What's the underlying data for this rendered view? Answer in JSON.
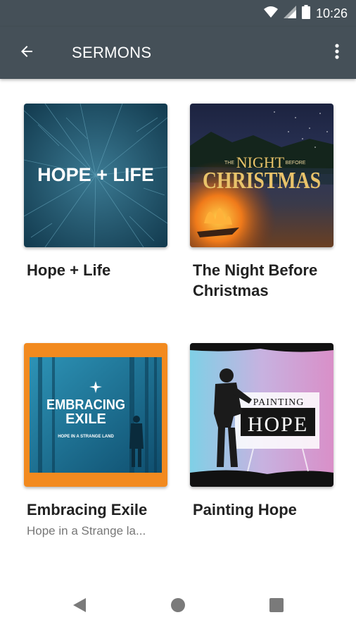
{
  "status_bar": {
    "time": "10:26",
    "icons": [
      "wifi-icon",
      "cellular-signal-icon",
      "battery-icon"
    ]
  },
  "app_bar": {
    "title": "SERMONS",
    "back_icon": "arrow-back-icon",
    "menu_icon": "more-vert-icon"
  },
  "sermons": [
    {
      "title": "Hope + Life",
      "subtitle": "",
      "art_text": "HOPE + LIFE"
    },
    {
      "title": "The Night Before Christmas",
      "subtitle": "",
      "art_text_top": "NIGHT",
      "art_text_small_left": "THE",
      "art_text_small_right": "BEFORE",
      "art_text_main": "CHRISTMAS"
    },
    {
      "title": "Embracing Exile",
      "subtitle": "Hope in a Strange la...",
      "art_text_line1": "EMBRACING",
      "art_text_line2": "EXILE",
      "art_text_sub": "HOPE IN A STRANGE LAND"
    },
    {
      "title": "Painting Hope",
      "subtitle": "",
      "art_text_top": "PAINTING",
      "art_text_main": "HOPE"
    }
  ],
  "nav_bar": {
    "icons": [
      "back-triangle-icon",
      "home-circle-icon",
      "recents-square-icon"
    ]
  },
  "colors": {
    "app_bar": "#455058",
    "title_text": "#222222",
    "subtitle_text": "#777777"
  }
}
